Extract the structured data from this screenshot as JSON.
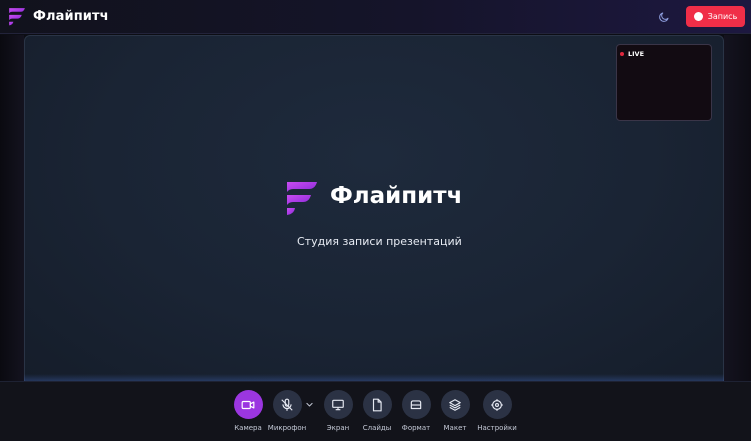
{
  "app": {
    "name": "Флайпитч",
    "logo_icon": "flypitch-logo-icon",
    "brand_gradient": [
      "#c046f0",
      "#8a2ad8"
    ]
  },
  "header": {
    "theme_toggle_icon": "moon-icon",
    "record_button": {
      "label": "Запись",
      "icon": "record-dot-icon",
      "color": "#f02e48"
    }
  },
  "preview": {
    "live_label": "LIVE",
    "live_color": "#e0283e"
  },
  "stage": {
    "title": "Флайпитч",
    "subtitle": "Студия записи презентаций"
  },
  "toolbar": {
    "accent": "#9b36e0",
    "items": [
      {
        "id": "camera",
        "label": "Камера",
        "icon": "video-camera-icon",
        "active": true
      },
      {
        "id": "mic",
        "label": "Микрофон",
        "icon": "microphone-off-icon",
        "active": false,
        "has_dropdown": true,
        "dropdown_icon": "chevron-down-icon"
      },
      {
        "id": "screen",
        "label": "Экран",
        "icon": "monitor-icon",
        "active": false
      },
      {
        "id": "slides",
        "label": "Слайды",
        "icon": "file-icon",
        "active": false
      },
      {
        "id": "format",
        "label": "Формат",
        "icon": "format-frame-icon",
        "active": false
      },
      {
        "id": "layout",
        "label": "Макет",
        "icon": "layers-icon",
        "active": false
      },
      {
        "id": "settings",
        "label": "Настройки",
        "icon": "settings-icon",
        "active": false
      }
    ]
  }
}
